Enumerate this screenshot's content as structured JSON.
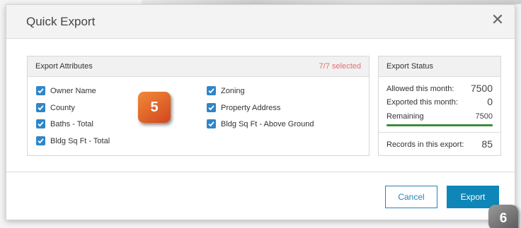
{
  "modal": {
    "title": "Quick Export",
    "close_icon": "close-icon"
  },
  "attributes": {
    "header": "Export Attributes",
    "selected_count": "7/7 selected",
    "items": [
      {
        "label": "Owner Name",
        "checked": true
      },
      {
        "label": "County",
        "checked": true
      },
      {
        "label": "Baths - Total",
        "checked": true
      },
      {
        "label": "Bldg Sq Ft - Total",
        "checked": true
      },
      {
        "label": "Zoning",
        "checked": true
      },
      {
        "label": "Property Address",
        "checked": true
      },
      {
        "label": "Bldg Sq Ft - Above Ground",
        "checked": true
      }
    ]
  },
  "status": {
    "header": "Export Status",
    "allowed_label": "Allowed this month:",
    "allowed_value": "7500",
    "exported_label": "Exported this month:",
    "exported_value": "0",
    "remaining_label": "Remaining",
    "remaining_value": "7500",
    "records_label": "Records in this export:",
    "records_value": "85",
    "bar_color": "#3c8c3c"
  },
  "footer": {
    "cancel_label": "Cancel",
    "export_label": "Export"
  },
  "callouts": {
    "step5": "5",
    "step6": "6"
  },
  "colors": {
    "accent": "#0f86b8",
    "checkbox": "#2f86c8",
    "selected_count": "#e07070"
  }
}
